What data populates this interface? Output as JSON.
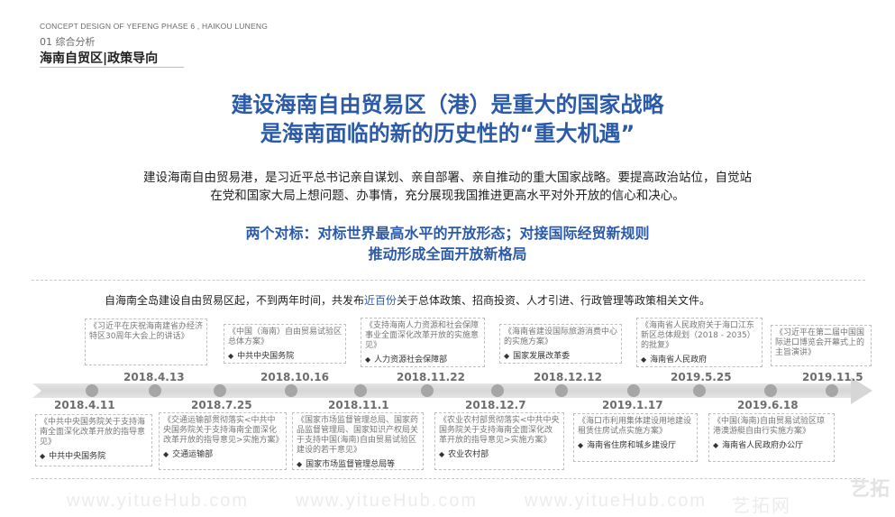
{
  "header": {
    "project": "CONCEPT DESIGN OF YEFENG PHASE 6  , HAIKOU LUNENG",
    "section": "01 综合分析",
    "title": "海南自贸区|政策导向"
  },
  "headline": {
    "line1": "建设海南自由贸易区（港）是重大的国家战略",
    "line2": "是海南面临的新的历史性的“重大机遇”"
  },
  "intro": {
    "line1": "建设海南自由贸易港，是习近平总书记亲自谋划、亲自部署、亲自推动的重大国家战略。要提高政治站位，自觉站",
    "line2": "在党和国家大局上想问题、办事情，充分展现我国推进更高水平对外开放的信心和决心。"
  },
  "subheadline": {
    "line1": "两个对标：对标世界最高水平的开放形态；对接国际经贸新规则",
    "line2": "推动形成全面开放新格局"
  },
  "statement": {
    "before": "自海南全岛建设自由贸易区起，不到两年时间，共发布",
    "highlight": "近百份",
    "after": "关于总体政策、招商投资、人才引进、行政管理等政策相关文件。"
  },
  "timeline": {
    "top_events": [
      {
        "date": "2018.4.13",
        "title": "《习近平在庆祝海南建省办经济特区30周年大会上的讲话》",
        "source": ""
      },
      {
        "date": "2018.10.16",
        "title": "《中国（海南）自由贸易试验区总体方案》",
        "source": "中共中央国务院"
      },
      {
        "date": "2018.11.22",
        "title": "《支持海南人力资源和社会保障事业全面深化改革开放的实施意见》",
        "source": "人力资源社会保障部"
      },
      {
        "date": "2018.12.12",
        "title": "《海南省建设国际旅游消费中心的实施方案》",
        "source": "国家发展改革委"
      },
      {
        "date": "2019.5.25",
        "title": "《海南省人民政府关于海口江东新区总体规划（2018 - 2035）的批复》",
        "source": "海南省人民政府"
      },
      {
        "date": "2019.11.5",
        "title": "《习近平在第二届中国国际进口博览会开幕式上的主旨演讲》",
        "source": ""
      }
    ],
    "bottom_events": [
      {
        "date": "2018.4.11",
        "title": "《中共中央国务院关于支持海南全面深化改革开放的指导意见》",
        "source": "中共中央国务院"
      },
      {
        "date": "2018.7.25",
        "title": "《交通运输部贯彻落实<中共中央国务院关于支持海南全面深化改革开放的指导意见>实施方案》",
        "source": "交通运输部"
      },
      {
        "date": "2018.11.1",
        "title": "《国家市场监督管理总局、国家药品监督管理局、国家知识产权局关于支持中国(海南)自由贸易试验区建设的若干意见》",
        "source": "国家市场监督管理总局等"
      },
      {
        "date": "2018.12.7",
        "title": "《农业农村部贯彻落实<中共中央国务院关于支持海南全面深化改革开放的指导意见>实施方案》",
        "source": "农业农村部"
      },
      {
        "date": "2019.1.17",
        "title": "《海口市利用集体建设用地建设租赁住房试点实施方案》",
        "source": "海南省住房和城乡建设厅"
      },
      {
        "date": "2019.6.18",
        "title": "《中国(海南)自由贸易试验区琼港澳游艇自由行实施方案》",
        "source": "海南省人民政府办公厅"
      }
    ]
  },
  "watermark": {
    "url": "www.yitueHub.com",
    "brand": "艺拓网",
    "logo": "艺拓"
  }
}
